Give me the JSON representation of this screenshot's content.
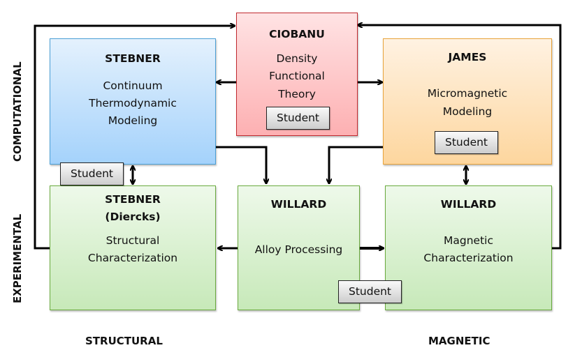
{
  "axes": {
    "computational": "COMPUTATIONAL",
    "experimental": "EXPERIMENTAL",
    "structural": "STRUCTURAL",
    "magnetic": "MAGNETIC"
  },
  "boxes": {
    "stebner_model": {
      "title": "STEBNER",
      "lines": [
        "Continuum",
        "Thermodynamic",
        "Modeling"
      ],
      "color": "#a4d2fb"
    },
    "ciobanu": {
      "title": "CIOBANU",
      "lines": [
        "Density",
        "Functional",
        "Theory"
      ],
      "student": "Student",
      "color": "#fdb0b2"
    },
    "james": {
      "title": "JAMES",
      "lines": [
        "Micromagnetic",
        "Modeling"
      ],
      "student": "Student",
      "color": "#fdd69e"
    },
    "stebner_exp": {
      "title": "STEBNER",
      "title2": "(Diercks)",
      "lines": [
        "Structural",
        "Characterization"
      ],
      "color": "#c7e9b9"
    },
    "willard_alloy": {
      "title": "WILLARD",
      "lines": [
        "Alloy Processing"
      ],
      "color": "#c7e9b9"
    },
    "willard_mag": {
      "title": "WILLARD",
      "lines": [
        "Magnetic",
        "Characterization"
      ],
      "color": "#c7e9b9"
    }
  },
  "students": {
    "stebner": "Student",
    "willard": "Student"
  },
  "connections": [
    {
      "from": "stebner_exp",
      "to": "ciobanu",
      "type": "arrow"
    },
    {
      "from": "willard_mag",
      "to": "ciobanu",
      "type": "arrow"
    },
    {
      "from": "ciobanu",
      "to": "stebner_model",
      "type": "arrow"
    },
    {
      "from": "ciobanu",
      "to": "james",
      "type": "arrow"
    },
    {
      "from": "stebner_model",
      "to": "willard_alloy",
      "type": "arrow"
    },
    {
      "from": "james",
      "to": "willard_alloy",
      "type": "arrow"
    },
    {
      "from": "stebner_model",
      "to": "stebner_exp",
      "type": "bidirectional"
    },
    {
      "from": "james",
      "to": "willard_mag",
      "type": "bidirectional"
    },
    {
      "from": "willard_alloy",
      "to": "stebner_exp",
      "type": "arrow"
    },
    {
      "from": "willard_alloy",
      "to": "willard_mag",
      "type": "arrow"
    }
  ]
}
